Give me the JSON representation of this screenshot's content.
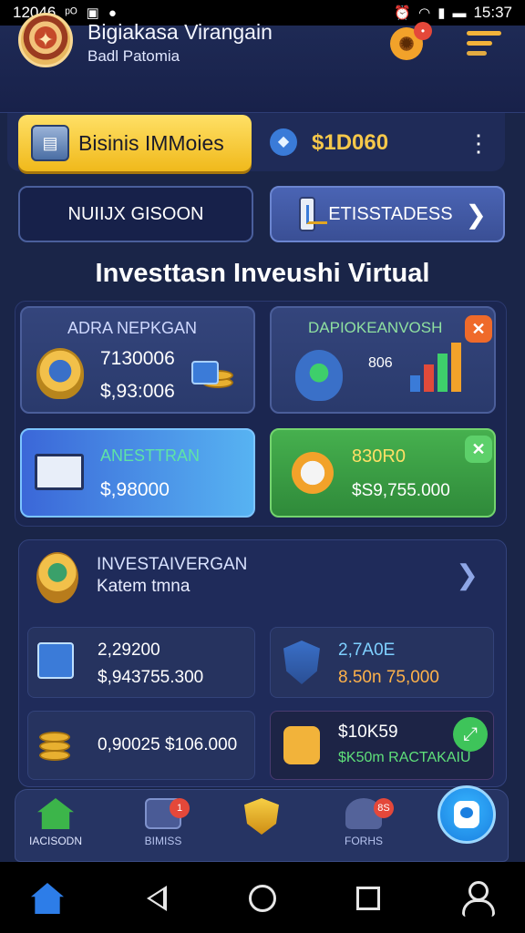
{
  "status_bar": {
    "left_text": "12046",
    "left_glyph": "ᵖᴼ",
    "time": "15:37"
  },
  "header": {
    "title": "Bigiakasa Virangain",
    "subtitle": "Badl Patomia",
    "notification_count": "•"
  },
  "balance": {
    "business_button_label": "Bisinis IMMoies",
    "value": "$1D060",
    "accent": "#f6c84a"
  },
  "actions": {
    "left_label": "NUIIJX GISOON",
    "right_label": "ETISSTADESS"
  },
  "section_title": "Investtasn Inveushi Virtual",
  "cards": [
    {
      "label": "ADRA NEPKGAN",
      "value1": "7130006",
      "value2": "$,93:006"
    },
    {
      "label": "DAPIOKEANVOSH",
      "value1": "806"
    },
    {
      "label": "ANESTTRAN",
      "value1": "$,98000"
    },
    {
      "label": "830R0",
      "value1": "$S9,755.000"
    }
  ],
  "investments": {
    "title": "INVESTAIVERGAN",
    "subtitle": "Katem tmna",
    "tiles": [
      {
        "line1": "2,29200",
        "line2": "$,943755.300"
      },
      {
        "line1": "2,7A0E",
        "line2": "8.50n 75,000"
      },
      {
        "line1": "0,90025 $106.000",
        "line2": ""
      },
      {
        "line1": "$10K59",
        "line2": "$K50m RACTAKAIU"
      }
    ]
  },
  "bottom_nav": {
    "items": [
      {
        "label": "IACISODN"
      },
      {
        "label": "BIMISS",
        "badge": "1"
      },
      {
        "label": ""
      },
      {
        "label": "FORHS",
        "badge": "8S"
      }
    ]
  },
  "colors": {
    "background": "#1a2548",
    "green_card": "#46b04e",
    "blue_card": "#3b67d8",
    "yellow_button": "#f0b91b",
    "alert_red": "#e4483a"
  },
  "icons": {
    "logo": "emblem-icon",
    "gear": "gear-icon",
    "menu": "menu-icon",
    "gem": "gem-icon",
    "more": "more-vertical-icon",
    "fab": "profile-badge-icon"
  }
}
